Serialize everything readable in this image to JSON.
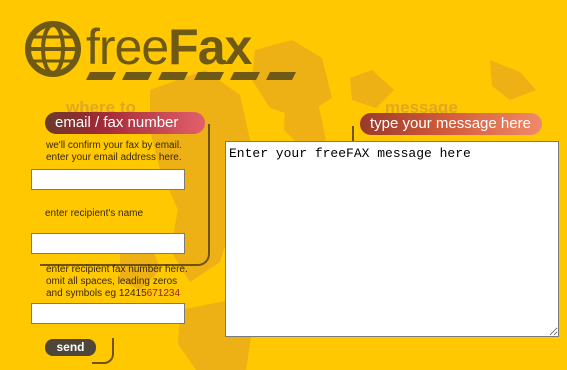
{
  "brand": {
    "free": "free",
    "fax": "Fax"
  },
  "left_panel": {
    "header_ghost": "where to",
    "header_pill": "email / fax number",
    "email_help": [
      "we'll confirm your fax by email.",
      "enter your email address here."
    ],
    "email_value": "",
    "recipient_label": "enter recipient's name",
    "recipient_value": "",
    "fax_help": [
      "enter recipient fax number here.",
      "omit all spaces, leading zeros",
      "and symbols eg "
    ],
    "fax_example_a": "12415",
    "fax_example_b": "671234",
    "fax_value": "",
    "send_label": "send"
  },
  "right_panel": {
    "header_ghost": "message",
    "header_pill": "type your message here",
    "message_value": "Enter your freeFAX message here"
  },
  "colors": {
    "background": "#ffc800",
    "logo": "#6e5a16",
    "pill_left": "#a02a36",
    "pill_right": "#cf5a3a",
    "send_button": "#4f463a"
  },
  "icons": {
    "logo": "globe-icon"
  }
}
